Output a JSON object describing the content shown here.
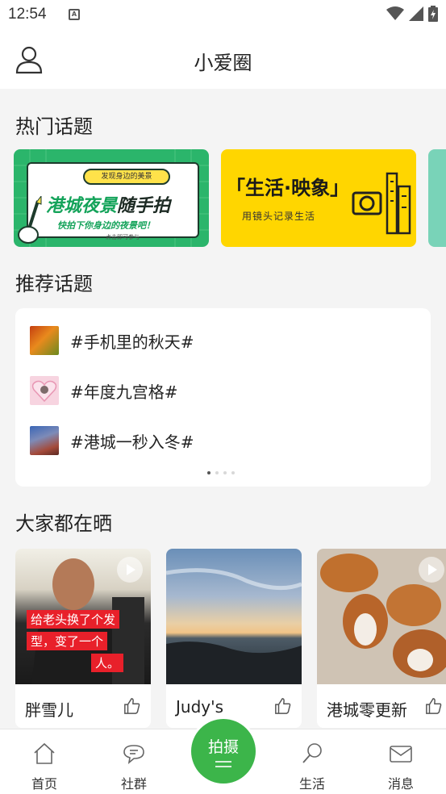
{
  "status_bar": {
    "time": "12:54",
    "notification_glyph": "A"
  },
  "header": {
    "title": "小爱圈",
    "profile_icon": "person-icon"
  },
  "hot_topics": {
    "title": "热门话题",
    "banners": [
      {
        "pill": "发现身边的美景",
        "title_green": "港城夜景",
        "title_dark": "随手拍",
        "subtitle": "快拍下你身边的夜景吧！",
        "tiny": "点击即可参与"
      },
      {
        "title": "「生活·映象」",
        "subtitle": "用镜头记录生活"
      },
      {
        "title": ""
      }
    ]
  },
  "recommended_topics": {
    "title": "推荐话题",
    "items": [
      {
        "label": "#手机里的秋天#"
      },
      {
        "label": "#年度九宫格#"
      },
      {
        "label": "#港城一秒入冬#"
      }
    ],
    "pager": {
      "count": 4,
      "active": 1
    }
  },
  "everyone_sharing": {
    "title": "大家都在晒",
    "posts": [
      {
        "name": "胖雪儿",
        "video": true,
        "caption": [
          "给老头换了个发",
          "型，变了一个",
          "人。"
        ]
      },
      {
        "name": "Judy's",
        "video": false
      },
      {
        "name": "港城零更新",
        "video": true
      }
    ]
  },
  "bottom_nav": {
    "items": [
      {
        "label": "首页",
        "icon": "home-icon"
      },
      {
        "label": "社群",
        "icon": "chat-bubble-icon"
      },
      {
        "label": "生活",
        "icon": "search-icon"
      },
      {
        "label": "消息",
        "icon": "mail-icon"
      }
    ],
    "shoot_label": "拍摄"
  },
  "colors": {
    "accent": "#3cb54a",
    "banner_yellow": "#ffd600",
    "banner_green": "#2bb56b"
  }
}
